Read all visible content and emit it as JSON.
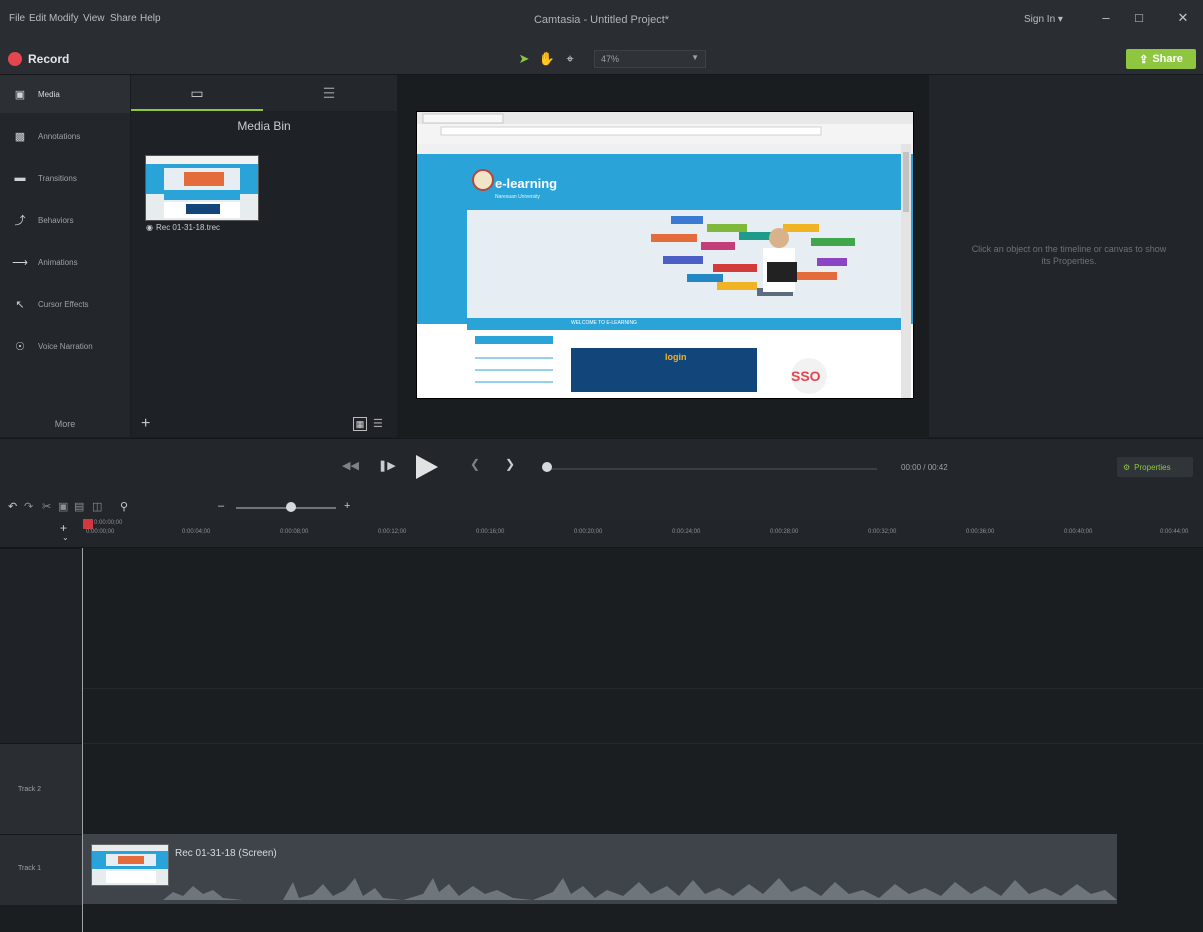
{
  "menu": {
    "items": [
      "File",
      "Edit",
      "Modify",
      "View",
      "Share",
      "Help"
    ],
    "title": "Camtasia - Untitled Project*",
    "signin": "Sign In ▾",
    "window_controls": [
      "–",
      "□",
      "✕"
    ]
  },
  "toolbar": {
    "record_label": "Record",
    "zoom_value": "47%",
    "share_label": "Share",
    "tools": [
      "pointer-icon",
      "hand-icon",
      "crop-icon"
    ]
  },
  "left_rail": {
    "items": [
      {
        "label": "Media",
        "icon": "media-icon"
      },
      {
        "label": "Annotations",
        "icon": "annotations-icon"
      },
      {
        "label": "Transitions",
        "icon": "transitions-icon"
      },
      {
        "label": "Behaviors",
        "icon": "behaviors-icon"
      },
      {
        "label": "Animations",
        "icon": "animations-icon"
      },
      {
        "label": "Cursor Effects",
        "icon": "cursor-effects-icon"
      },
      {
        "label": "Voice Narration",
        "icon": "microphone-icon"
      }
    ],
    "more_label": "More"
  },
  "media_bin": {
    "title": "Media Bin",
    "item_label": "Rec 01-31-18.trec"
  },
  "canvas": {
    "site_title": "e-learning",
    "site_subtitle": "Naresuan University",
    "announcement": "WELCOME TO E-LEARNING",
    "login_button": "login",
    "sso_label": "SSO"
  },
  "properties": {
    "hint": "Click an object on the timeline or canvas to show its Properties."
  },
  "playback": {
    "timecode": "00:00 / 00:42",
    "properties_label": "Properties"
  },
  "timeline": {
    "playhead_time": "0:00:00;00",
    "ticks": [
      "0:00:00;00",
      "0:00:04;00",
      "0:00:08;00",
      "0:00:12;00",
      "0:00:16;00",
      "0:00:20;00",
      "0:00:24;00",
      "0:00:28;00",
      "0:00:32;00",
      "0:00:36;00",
      "0:00:40;00",
      "0:00:44;00"
    ],
    "tracks": [
      "Track 2",
      "Track 1"
    ],
    "clip_name": "Rec 01-31-18 (Screen)"
  },
  "colors": {
    "accent_green": "#8ec63f",
    "record_red": "#e5464d",
    "site_blue": "#2aa3d8"
  }
}
